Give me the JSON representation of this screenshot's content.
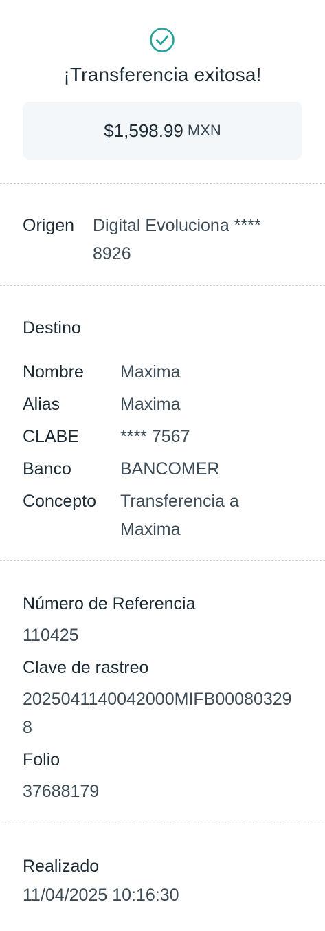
{
  "header": {
    "title": "¡Transferencia exitosa!",
    "accent_color": "#22a49a",
    "amount": "$1,598.99",
    "currency": "MXN"
  },
  "origen": {
    "label": "Origen",
    "value": "Digital Evoluciona **** 8926"
  },
  "destino": {
    "title": "Destino",
    "rows": [
      {
        "label": "Nombre",
        "value": "Maxima"
      },
      {
        "label": "Alias",
        "value": "Maxima"
      },
      {
        "label": "CLABE",
        "value": "**** 7567"
      },
      {
        "label": "Banco",
        "value": "BANCOMER"
      },
      {
        "label": "Concepto",
        "value": "Transferencia a Maxima"
      }
    ]
  },
  "referencias": {
    "numero_label": "Número de Referencia",
    "numero_value": "110425",
    "clave_label": "Clave de rastreo",
    "clave_value": "2025041140042000MIFB000803298",
    "folio_label": "Folio",
    "folio_value": "37688179"
  },
  "realizado": {
    "label": "Realizado",
    "value": "11/04/2025 10:16:30"
  }
}
